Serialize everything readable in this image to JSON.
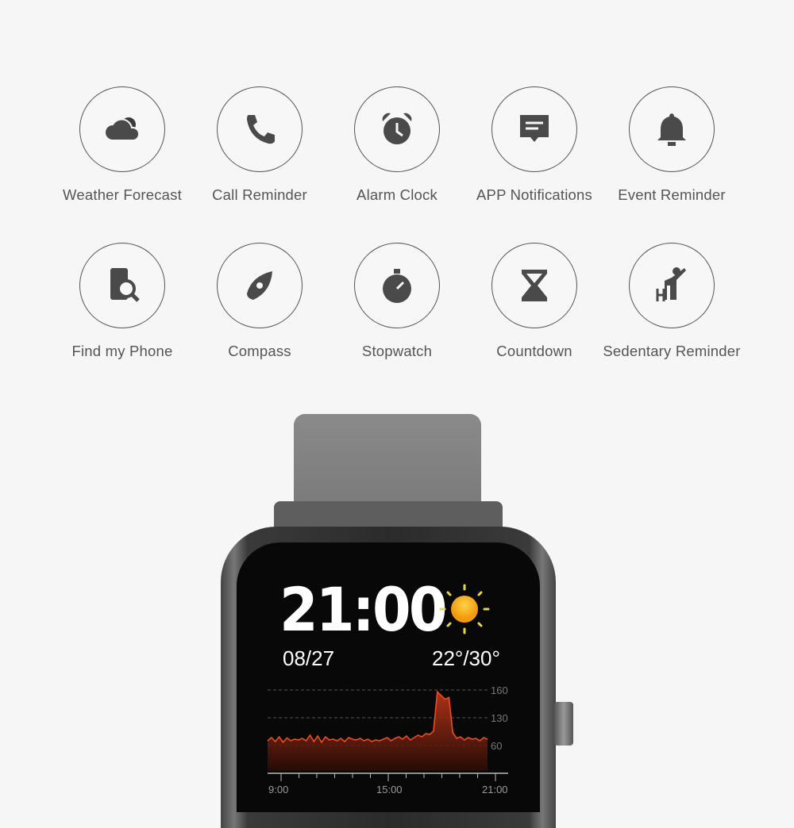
{
  "features": [
    {
      "label": "Weather Forecast",
      "icon": "weather-cloud-icon"
    },
    {
      "label": "Call Reminder",
      "icon": "phone-icon"
    },
    {
      "label": "Alarm Clock",
      "icon": "alarm-clock-icon"
    },
    {
      "label": "APP Notifications",
      "icon": "message-icon"
    },
    {
      "label": "Event Reminder",
      "icon": "bell-icon"
    },
    {
      "label": "Find my Phone",
      "icon": "find-phone-icon"
    },
    {
      "label": "Compass",
      "icon": "compass-icon"
    },
    {
      "label": "Stopwatch",
      "icon": "stopwatch-icon"
    },
    {
      "label": "Countdown",
      "icon": "hourglass-icon"
    },
    {
      "label": "Sedentary Reminder",
      "icon": "stretching-person-icon"
    }
  ],
  "watch": {
    "time": "21:00",
    "date": "08/27",
    "temperature": "22°/30°",
    "weather_icon": "sun-icon",
    "heart_rate": {
      "y_ticks": [
        "160",
        "130",
        "60"
      ],
      "x_ticks": [
        "9:00",
        "15:00",
        "21:00"
      ],
      "line_color": "#f04a22",
      "values": [
        72,
        80,
        70,
        82,
        68,
        79,
        72,
        76,
        74,
        78,
        72,
        86,
        70,
        84,
        68,
        82,
        74,
        76,
        72,
        78,
        70,
        80,
        76,
        74,
        78,
        72,
        76,
        70,
        74,
        72,
        76,
        80,
        72,
        78,
        82,
        76,
        84,
        74,
        80,
        86,
        82,
        90,
        88,
        96,
        158,
        154,
        150,
        152,
        92,
        78,
        82,
        74,
        80,
        76,
        78,
        72,
        80,
        76
      ]
    }
  }
}
